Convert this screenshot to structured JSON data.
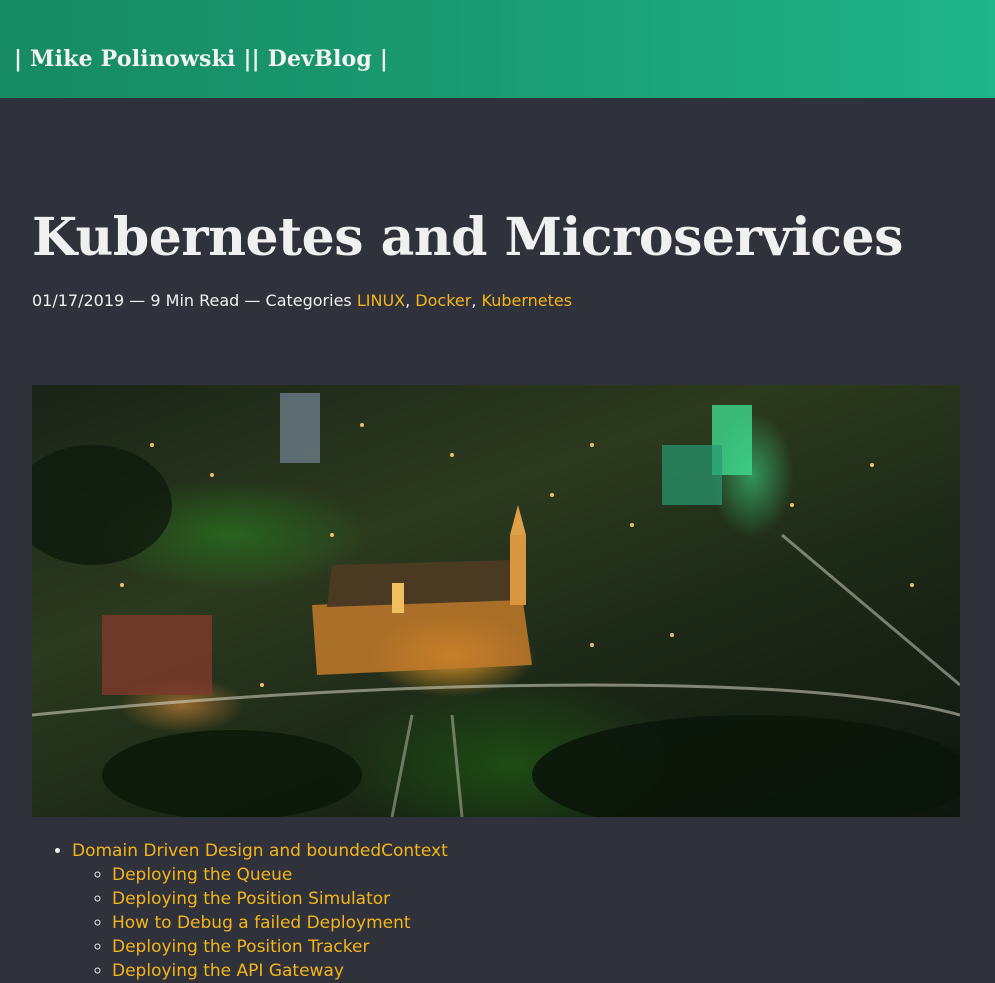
{
  "header": {
    "site_title": "| Mike Polinowski || DevBlog |"
  },
  "post": {
    "title": "Kubernetes and Microservices",
    "date": "01/17/2019",
    "sep1": " — ",
    "read_time": "9 Min Read",
    "sep2": " — Categories ",
    "categories": [
      "LINUX",
      "Docker",
      "Kubernetes"
    ],
    "comma": ", "
  },
  "hero_image": {
    "description": "night aerial city photo"
  },
  "toc": {
    "item": "Domain Driven Design and boundedContext",
    "subitems": [
      "Deploying the Queue",
      "Deploying the Position Simulator",
      "How to Debug a failed Deployment",
      "Deploying the Position Tracker",
      "Deploying the API Gateway"
    ]
  }
}
